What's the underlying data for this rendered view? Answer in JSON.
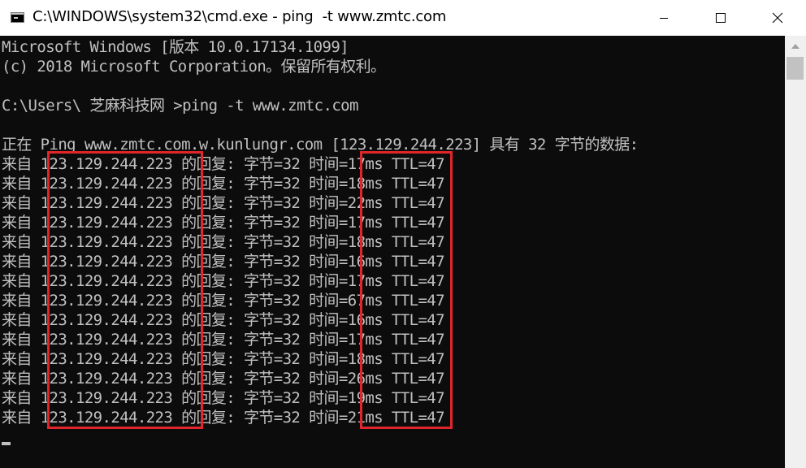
{
  "window": {
    "title": "C:\\WINDOWS\\system32\\cmd.exe - ping  -t www.zmtc.com"
  },
  "console": {
    "header": [
      "Microsoft Windows [版本 10.0.17134.1099]",
      "(c) 2018 Microsoft Corporation。保留所有权利。",
      "",
      "C:\\Users\\ 芝麻科技网 >ping -t www.zmtc.com",
      "",
      "正在 Ping www.zmtc.com.w.kunlungr.com [123.129.244.223] 具有 32 字节的数据:"
    ],
    "replies": [
      "来自 123.129.244.223 的回复: 字节=32 时间=17ms TTL=47",
      "来自 123.129.244.223 的回复: 字节=32 时间=18ms TTL=47",
      "来自 123.129.244.223 的回复: 字节=32 时间=22ms TTL=47",
      "来自 123.129.244.223 的回复: 字节=32 时间=17ms TTL=47",
      "来自 123.129.244.223 的回复: 字节=32 时间=18ms TTL=47",
      "来自 123.129.244.223 的回复: 字节=32 时间=16ms TTL=47",
      "来自 123.129.244.223 的回复: 字节=32 时间=17ms TTL=47",
      "来自 123.129.244.223 的回复: 字节=32 时间=67ms TTL=47",
      "来自 123.129.244.223 的回复: 字节=32 时间=16ms TTL=47",
      "来自 123.129.244.223 的回复: 字节=32 时间=17ms TTL=47",
      "来自 123.129.244.223 的回复: 字节=32 时间=18ms TTL=47",
      "来自 123.129.244.223 的回复: 字节=32 时间=26ms TTL=47",
      "来自 123.129.244.223 的回复: 字节=32 时间=19ms TTL=47",
      "来自 123.129.244.223 的回复: 字节=32 时间=21ms TTL=47"
    ]
  },
  "colors": {
    "console_background": "#0c0c0c",
    "console_text": "#c0c0c0",
    "highlight": "#e0262b"
  },
  "icons": {
    "app": "cmd-icon",
    "minimize": "minimize-icon",
    "maximize": "maximize-icon",
    "close": "close-icon",
    "scroll_up": "scroll-up-arrow-icon"
  }
}
